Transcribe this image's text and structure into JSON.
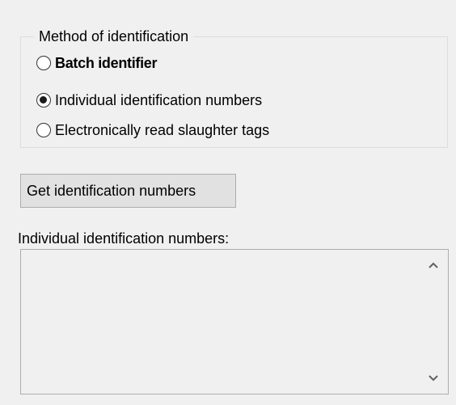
{
  "method_group": {
    "title": "Method of identification",
    "options": [
      {
        "label": "Batch identifier",
        "selected": false
      },
      {
        "label": "Individual identification numbers",
        "selected": true
      },
      {
        "label": "Electronically read slaughter tags",
        "selected": false
      }
    ]
  },
  "get_button_label": "Get identification numbers",
  "numbers_list": {
    "label": "Individual identification numbers:",
    "items": []
  },
  "icons": {
    "scroll_up": "chevron-up-icon",
    "scroll_down": "chevron-down-icon"
  }
}
